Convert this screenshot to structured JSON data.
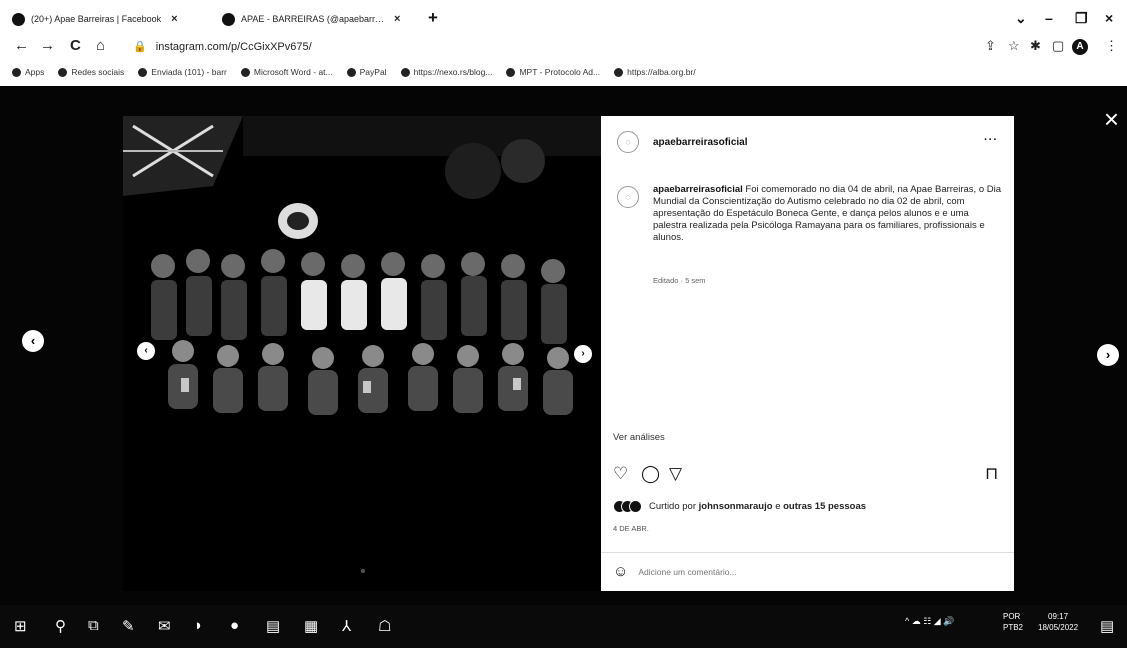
{
  "browser": {
    "tabs": [
      {
        "title": "(20+) Apae Barreiras | Facebook",
        "close": "×"
      },
      {
        "title": "APAE - BARREIRAS (@apaebarr…",
        "close": "×"
      }
    ],
    "new_tab": "+",
    "window_controls": {
      "dropdown": "⌄",
      "minimize": "–",
      "maximize": "❐",
      "close": "×"
    },
    "nav": {
      "back": "←",
      "forward": "→",
      "reload": "C",
      "home": "⌂"
    },
    "url": "instagram.com/p/CcGixXPv675/",
    "lock": "🔒",
    "toolbar": {
      "share": "⇪",
      "star": "☆",
      "extensions": "✱",
      "sidebar": "▢",
      "profile_initial": "A",
      "menu": "⋮"
    },
    "bookmarks": [
      {
        "label": "Apps"
      },
      {
        "label": "Redes sociais"
      },
      {
        "label": "Enviada (101) - barr"
      },
      {
        "label": "Microsoft Word - at..."
      },
      {
        "label": "PayPal"
      },
      {
        "label": "https://nexo.rs/blog..."
      },
      {
        "label": "MPT - Protocolo Ad..."
      },
      {
        "label": "https://alba.org.br/"
      }
    ]
  },
  "viewer": {
    "close": "×",
    "prev": "‹",
    "next": "›",
    "photo_prev": "‹",
    "photo_next": "›"
  },
  "post": {
    "username": "apaebarreirasoficial",
    "more": "···",
    "caption_user": "apaebarreirasoficial",
    "caption_text": "Foi comemorado no dia 04 de abril, na Apae Barreiras, o Dia Mundial da Conscientização do Autismo celebrado no dia 02 de abril, com apresentação do Espetáculo Boneca Gente, e dança pelos alunos e e uma palestra realizada pela Psicóloga Ramayana para os familiares, profissionais e alunos.",
    "edited": "Editado · 5 sem",
    "insights": "Ver análises",
    "likes_prefix": "Curtido por",
    "likes_user": "johnsonmaraujo",
    "likes_middle": "e",
    "likes_others": "outras 15 pessoas",
    "date": "4 DE ABR.",
    "comment_placeholder": "Adicione um comentário...",
    "icons": {
      "like": "♡",
      "comment": "◯",
      "share": "▽",
      "save": "⊓",
      "emoji": "☺"
    }
  },
  "taskbar": {
    "start": "⊞",
    "search": "⚲",
    "apps": [
      "⧉",
      "✎",
      "✉",
      "◗",
      "●",
      "▤",
      "▦",
      "⅄",
      "☖"
    ],
    "tray": "^  ☁  ☷  ◢  🔊",
    "lang_line1": "POR",
    "lang_line2": "PTB2",
    "time": "09:17",
    "date": "18/05/2022",
    "notifications": "▤"
  }
}
